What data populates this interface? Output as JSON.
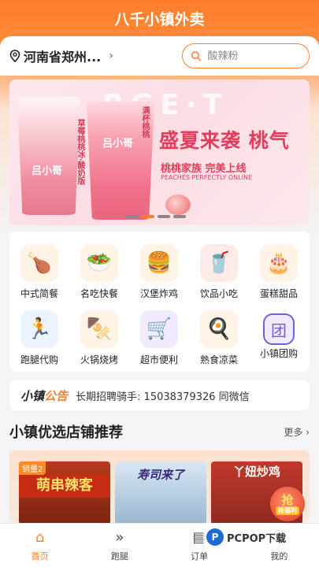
{
  "header": {
    "title": "八千小镇外卖"
  },
  "location": {
    "text": "河南省郑州..."
  },
  "search": {
    "placeholder": "酸辣粉"
  },
  "banner": {
    "bg_text": "RGE·T",
    "cup_logo_1": "吕小哥",
    "cup_logo_2": "吕小哥",
    "label_1": "草莓桃桃冰·酸奶版",
    "label_2": "满杯桃桃",
    "title": "盛夏来袭 桃气",
    "subtitle": "桃桃家族 完美上线",
    "english": "PEACHES PERFECTLY ONLINE",
    "slide_count": 4,
    "active_slide": 1
  },
  "categories": [
    {
      "label": "中式简餐",
      "icon": "roast-chicken-icon",
      "glyph": "🍗"
    },
    {
      "label": "名吃快餐",
      "icon": "food-bowl-icon",
      "glyph": "🥗"
    },
    {
      "label": "汉堡炸鸡",
      "icon": "burger-icon",
      "glyph": "🍔"
    },
    {
      "label": "饮品小吃",
      "icon": "drink-icon",
      "glyph": "🥤"
    },
    {
      "label": "蛋糕甜品",
      "icon": "cake-icon",
      "glyph": "🎂"
    },
    {
      "label": "跑腿代购",
      "icon": "runner-icon",
      "glyph": "🏃"
    },
    {
      "label": "火锅烧烤",
      "icon": "skewer-icon",
      "glyph": "🍢"
    },
    {
      "label": "超市便利",
      "icon": "shopping-basket-icon",
      "glyph": "🛒"
    },
    {
      "label": "熟食凉菜",
      "icon": "cooked-food-icon",
      "glyph": "🍳"
    },
    {
      "label": "小镇团购",
      "icon": "group-buy-icon",
      "glyph": "团"
    }
  ],
  "notice": {
    "brand_a": "小镇",
    "brand_b": "公告",
    "message": "长期招聘骑手: 15038379326 同微信"
  },
  "section": {
    "title": "小镇优选店铺推荐",
    "more": "更多 ›"
  },
  "stores": [
    {
      "badge": "销量2",
      "sign": "萌串辣客"
    },
    {
      "sign": "寿司来了"
    },
    {
      "sign": "丫妞炒鸡"
    }
  ],
  "promo": {
    "big": "抢",
    "small": "抢福利"
  },
  "tabs": [
    {
      "label": "首页",
      "icon": "home-icon",
      "glyph": "⌂",
      "active": true
    },
    {
      "label": "跑腿",
      "icon": "errand-icon",
      "glyph": "»",
      "active": false
    },
    {
      "label": "订单",
      "icon": "order-icon",
      "glyph": "▤",
      "active": false
    },
    {
      "label": "我的",
      "icon": "profile-icon",
      "glyph": "☺",
      "active": false
    }
  ],
  "watermark": {
    "badge": "P",
    "text": "PCPOP下载"
  },
  "colors": {
    "accent": "#ff7d2a",
    "banner_text": "#e43d5c"
  }
}
